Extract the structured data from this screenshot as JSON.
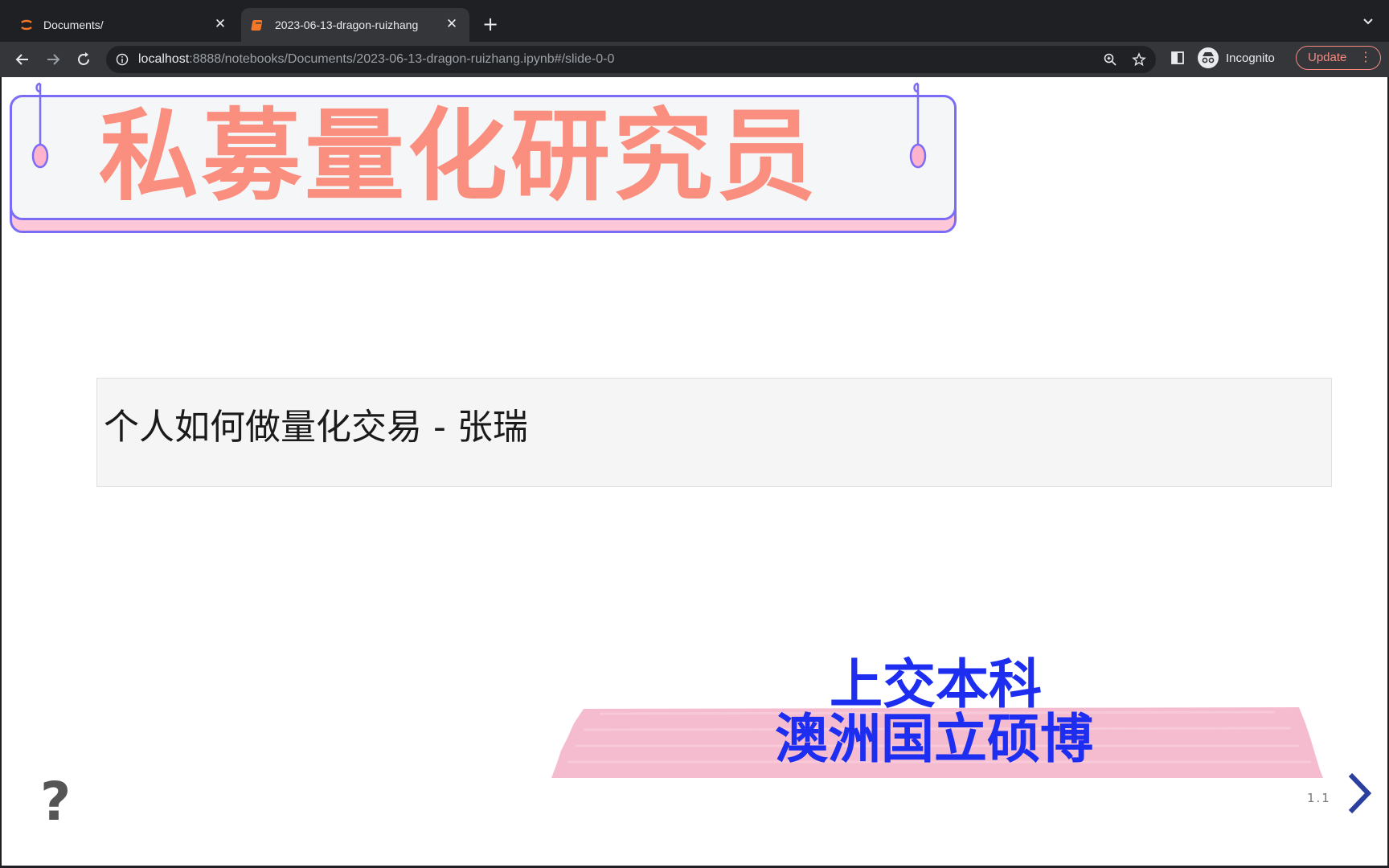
{
  "browser": {
    "tabs": [
      {
        "title": "Documents/",
        "active": false
      },
      {
        "title": "2023-06-13-dragon-ruizhang",
        "active": true
      }
    ],
    "new_tab_symbol": "+",
    "url_host": "localhost",
    "url_rest": ":8888/notebooks/Documents/2023-06-13-dragon-ruizhang.ipynb#/slide-0-0",
    "profile_label": "Incognito",
    "update_label": "Update",
    "accent": "#f28b82"
  },
  "slide": {
    "banner_title": "私募量化研究员",
    "subtitle": "个人如何做量化交易 - 张瑞",
    "credential_line_1": "上交本科",
    "credential_line_2": "澳洲国立硕博",
    "help_symbol": "?",
    "slide_number": "1.1",
    "colors": {
      "title": "#fa8e7f",
      "credentials": "#1d2ef0",
      "banner_border": "#7b6cf6",
      "tape": "#f5bcd0"
    }
  }
}
